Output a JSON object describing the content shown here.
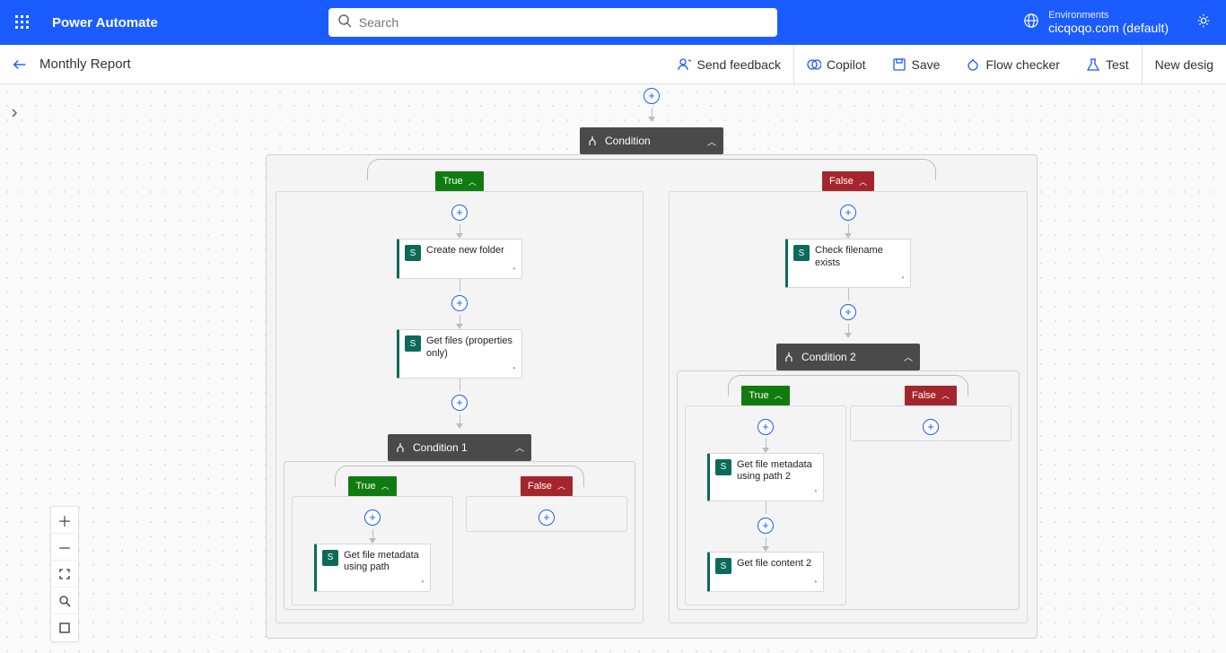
{
  "header": {
    "app_name": "Power Automate",
    "search_placeholder": "Search",
    "env_label": "Environments",
    "env_value": "cicqoqo.com (default)"
  },
  "cmdbar": {
    "flow_title": "Monthly Report",
    "actions": {
      "feedback": "Send feedback",
      "copilot": "Copilot",
      "save": "Save",
      "checker": "Flow checker",
      "test": "Test",
      "newdesigner": "New desig"
    }
  },
  "flow": {
    "cond0": "Condition",
    "true_label": "True",
    "false_label": "False",
    "left": {
      "create_folder": "Create new folder",
      "get_files": "Get files (properties only)",
      "cond1": "Condition 1",
      "get_meta_path": "Get file metadata using path"
    },
    "right": {
      "check_filename": "Check filename exists",
      "cond2": "Condition 2",
      "get_meta_path2": "Get file metadata using path 2",
      "get_content2": "Get file content 2"
    }
  }
}
